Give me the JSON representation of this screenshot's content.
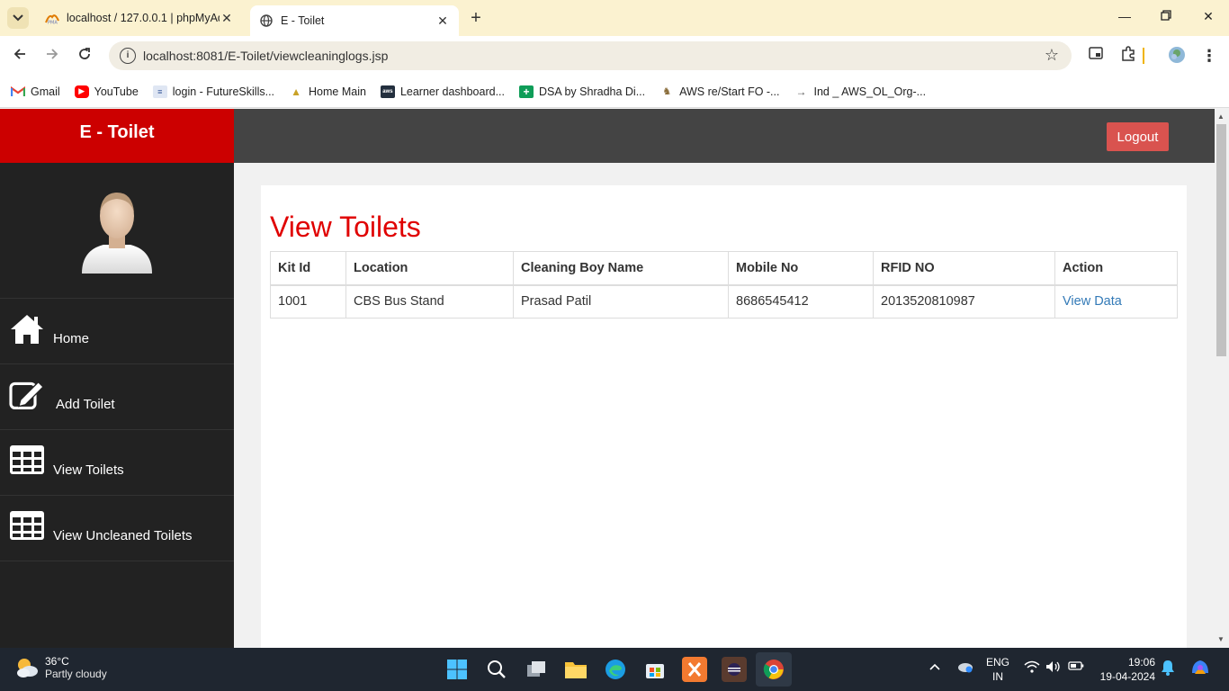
{
  "browser": {
    "tabs": [
      {
        "title": "localhost / 127.0.0.1 | phpMyAdmin",
        "icon": "phpmyadmin-icon",
        "active": false
      },
      {
        "title": "E - Toilet",
        "icon": "globe-icon",
        "active": true
      }
    ],
    "url": "localhost:8081/E-Toilet/viewcleaninglogs.jsp",
    "bookmarks": [
      {
        "label": "Gmail",
        "icon": "gmail-icon",
        "color": "#ea4335"
      },
      {
        "label": "YouTube",
        "icon": "youtube-icon",
        "color": "#ff0000"
      },
      {
        "label": "login - FutureSkills...",
        "icon": "futureskills-icon",
        "color": "#3a5a9a"
      },
      {
        "label": "Home Main",
        "icon": "home-main-icon",
        "color": "#c9a227"
      },
      {
        "label": "Learner dashboard...",
        "icon": "aws-icon",
        "color": "#232f3e"
      },
      {
        "label": "DSA by Shradha Di...",
        "icon": "sheets-icon",
        "color": "#0f9d58"
      },
      {
        "label": "AWS re/Start FO -...",
        "icon": "aws-restart-icon",
        "color": "#8a6d3b"
      },
      {
        "label": "Ind _ AWS_OL_Org-...",
        "icon": "arrow-icon",
        "color": "#555555"
      }
    ]
  },
  "app": {
    "brand": "E - Toilet",
    "logout_label": "Logout",
    "menu": [
      {
        "label": "Home",
        "icon": "home-icon"
      },
      {
        "label": "Add Toilet",
        "icon": "edit-icon"
      },
      {
        "label": "View Toilets",
        "icon": "table-icon"
      },
      {
        "label": "View Uncleaned Toilets",
        "icon": "table-icon"
      }
    ],
    "page_title": "View Toilets",
    "table": {
      "headers": [
        "Kit Id",
        "Location",
        "Cleaning Boy Name",
        "Mobile No",
        "RFID NO",
        "Action"
      ],
      "rows": [
        {
          "kit_id": "1001",
          "location": "CBS Bus Stand",
          "cleaning_boy": "Prasad Patil",
          "mobile": "8686545412",
          "rfid": "2013520810987",
          "action": "View Data"
        }
      ]
    },
    "colors": {
      "brand_red": "#cc0000",
      "title_red": "#e00000",
      "logout_red": "#d9534f",
      "link_blue": "#337ab7"
    }
  },
  "taskbar": {
    "weather_temp": "36°C",
    "weather_desc": "Partly cloudy",
    "lang_1": "ENG",
    "lang_2": "IN",
    "time": "19:06",
    "date": "19-04-2024"
  }
}
